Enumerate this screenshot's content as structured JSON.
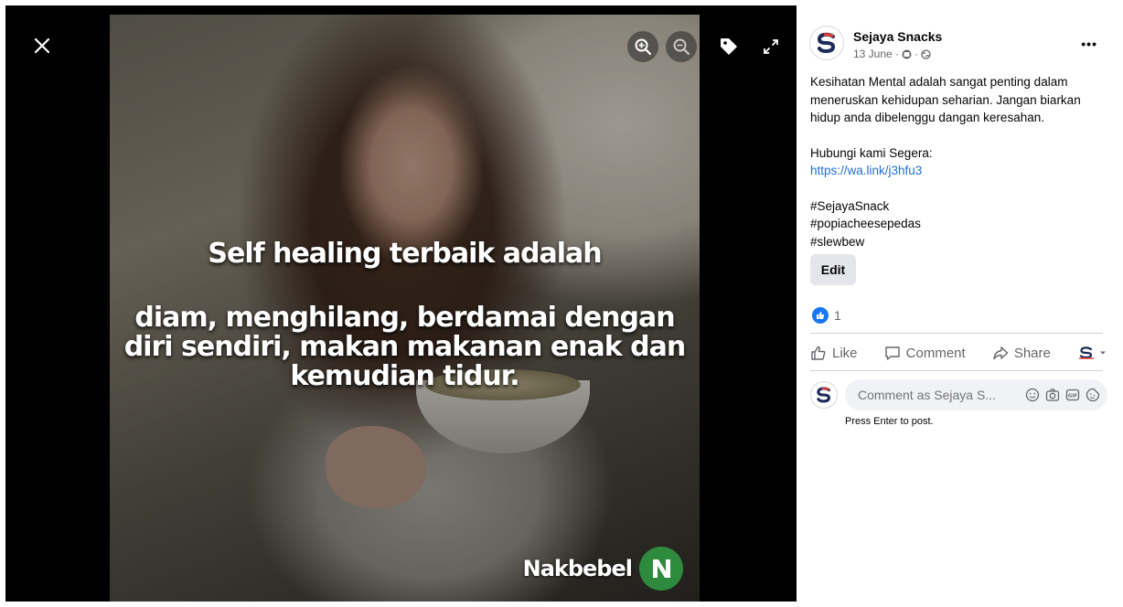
{
  "viewer": {
    "headline": "Self healing terbaik adalah",
    "subtext": "diam, menghilang, berdamai dengan diri sendiri, makan makanan enak dan kemudian tidur.",
    "watermark": "Nakbebel",
    "icons": [
      "close-icon",
      "zoom-in-icon",
      "zoom-out-icon",
      "tag-icon",
      "fullscreen-icon"
    ]
  },
  "post": {
    "page_name": "Sejaya Snacks",
    "date": "13 June ·",
    "paragraph1": "Kesihatan Mental adalah sangat penting dalam meneruskan kehidupan seharian. Jangan biarkan hidup anda dibelenggu dangan keresahan.",
    "contact_label": "Hubungi kami Segera:",
    "link": "https://wa.link/j3hfu3",
    "hashtags": [
      "#SejayaSnack",
      "#popiacheesepedas",
      "#slewbew"
    ],
    "more_label": "•••",
    "edit_label": "Edit",
    "reaction_count": "1"
  },
  "actions": {
    "like": "Like",
    "comment": "Comment",
    "share": "Share"
  },
  "comment": {
    "placeholder": "Comment as Sejaya S...",
    "hint": "Press Enter to post."
  },
  "colors": {
    "accent": "#1877f2",
    "link": "#216fdb",
    "watermark_logo": "#2e8b3e"
  }
}
